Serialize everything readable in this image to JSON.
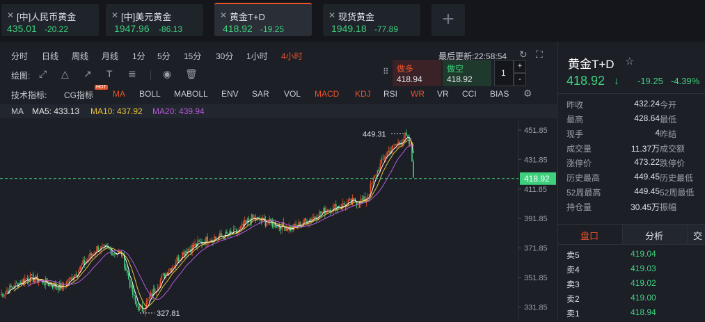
{
  "tabs": [
    {
      "name": "[中]人民币黄金",
      "price": "435.01",
      "change": "-20.22"
    },
    {
      "name": "[中]美元黄金",
      "price": "1947.96",
      "change": "-86.13"
    },
    {
      "name": "黄金T+D",
      "price": "418.92",
      "change": "-19.25"
    },
    {
      "name": "现货黄金",
      "price": "1949.18",
      "change": "-77.89"
    }
  ],
  "add_tab": "+",
  "periods": [
    "分时",
    "日线",
    "周线",
    "月线",
    "1分",
    "5分",
    "15分",
    "30分",
    "1小时",
    "4小时"
  ],
  "active_period": "4小时",
  "last_update": {
    "label": "最后更新:",
    "time": "22:58:54"
  },
  "draw_label": "绘图:",
  "indicators_label": "技术指标:",
  "indicators": [
    "CG指标",
    "MA",
    "BOLL",
    "MABOLL",
    "ENV",
    "SAR",
    "VOL",
    "MACD",
    "KDJ",
    "RSI",
    "WR",
    "VR",
    "CCI",
    "BIAS"
  ],
  "indicator_colors": {
    "MA": "#e8532b",
    "MACD": "#e8532b",
    "KDJ": "#e8532b",
    "WR": "#e8532b"
  },
  "hot_badge": "HOT",
  "ma_line": {
    "label": "MA",
    "ma5": "MA5: 433.13",
    "ma10": "MA10: 437.92",
    "ma20": "MA20: 439.94"
  },
  "order": {
    "buy_label": "做多",
    "buy_price": "418.94",
    "sell_label": "做空",
    "sell_price": "418.92",
    "qty": "1",
    "plus": "+",
    "minus": "-"
  },
  "chart_data": {
    "type": "candlestick",
    "yticks": [
      "451.85",
      "431.85",
      "411.85",
      "391.85",
      "371.85",
      "351.85",
      "331.85"
    ],
    "ylim": [
      325,
      457
    ],
    "current_price": "418.92",
    "high_label": "449.31",
    "low_label": "327.81",
    "colors": {
      "up": "#e8532b",
      "down": "#3fd07e",
      "ma5": "#ffffff",
      "ma10": "#e8c23a",
      "ma20": "#b45ad8",
      "price_line": "#3fd07e"
    }
  },
  "instrument": {
    "name": "黄金T+D",
    "price": "418.92",
    "arrow": "↓",
    "change": "-19.25",
    "percent": "-4.39%",
    "star": "☆"
  },
  "stats": [
    {
      "l": "昨收",
      "v": "432.24",
      "r": "今开"
    },
    {
      "l": "最高",
      "v": "428.64",
      "r": "最低"
    },
    {
      "l": "现手",
      "v": "4",
      "r": "昨结"
    },
    {
      "l": "成交量",
      "v": "11.37万",
      "r": "成交额"
    },
    {
      "l": "涨停价",
      "v": "473.22",
      "r": "跌停价"
    },
    {
      "l": "历史最高",
      "v": "449.45",
      "r": "历史最低"
    },
    {
      "l": "52周最高",
      "v": "449.45",
      "r": "52周最低"
    },
    {
      "l": "持仓量",
      "v": "30.45万",
      "r": "振幅"
    }
  ],
  "right_tabs": [
    "盘口",
    "分析",
    "交"
  ],
  "orderbook": [
    {
      "l": "卖5",
      "v": "419.04"
    },
    {
      "l": "卖4",
      "v": "419.03"
    },
    {
      "l": "卖3",
      "v": "419.02"
    },
    {
      "l": "卖2",
      "v": "419.00"
    },
    {
      "l": "卖1",
      "v": "418.94"
    }
  ]
}
